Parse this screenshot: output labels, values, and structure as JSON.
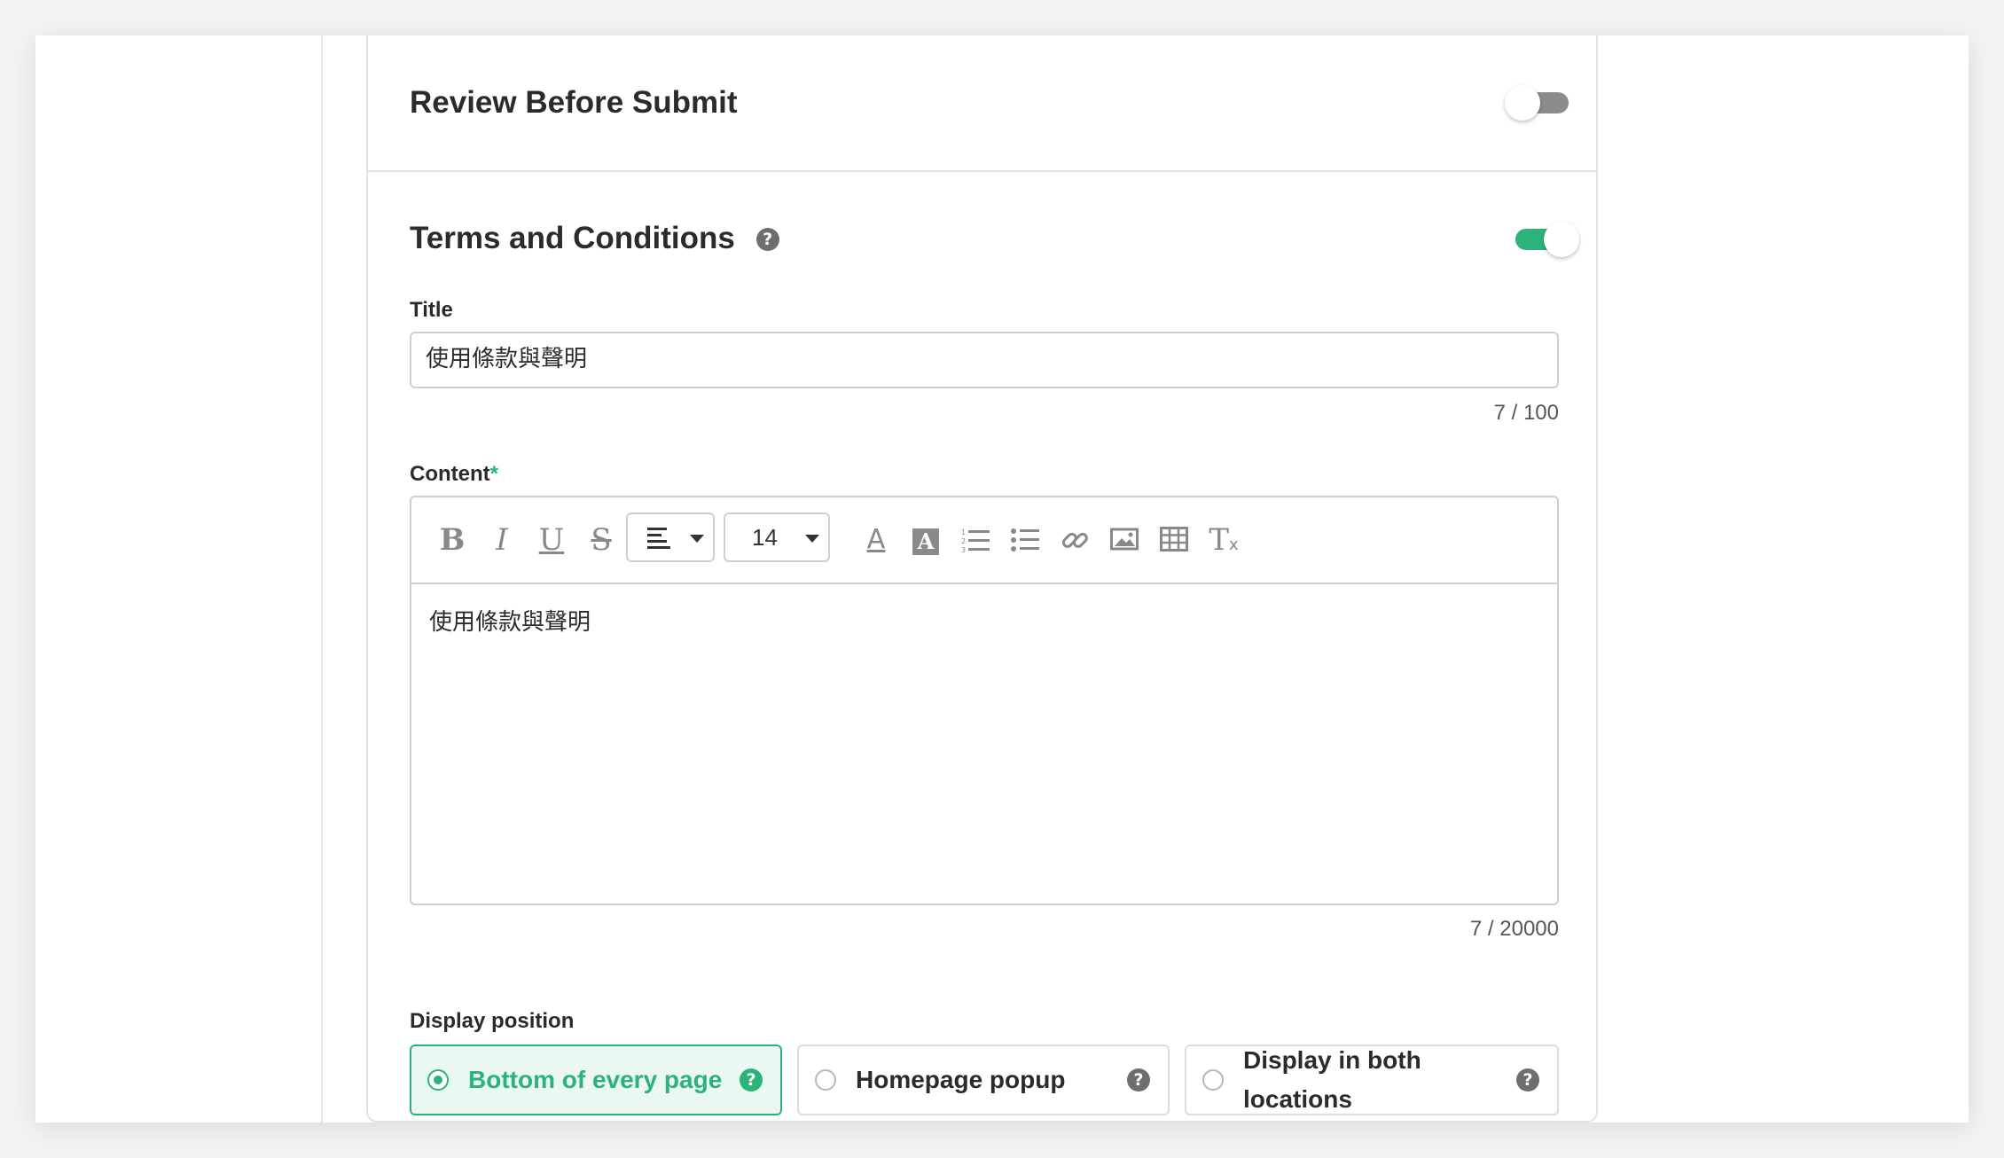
{
  "review": {
    "title": "Review Before Submit",
    "enabled": false
  },
  "terms": {
    "title": "Terms and Conditions",
    "help_icon": "question-circle-icon",
    "enabled": true,
    "title_field": {
      "label": "Title",
      "value": "使用條款與聲明",
      "counter": "7 / 100"
    },
    "content_field": {
      "label": "Content",
      "required_mark": "*",
      "toolbar": {
        "bold": "B",
        "italic": "I",
        "underline": "U",
        "strike": "S",
        "align_icon": "align-left-icon",
        "font_size": "14",
        "font_color": "A",
        "bg_color": "A",
        "clear_format": "T"
      },
      "text": "使用條款與聲明",
      "counter": "7 / 20000"
    },
    "display_position": {
      "label": "Display position",
      "options": [
        {
          "label": "Bottom of every page",
          "selected": true
        },
        {
          "label": "Homepage popup",
          "selected": false
        },
        {
          "label": "Display in both locations",
          "selected": false
        }
      ],
      "help_glyph": "?"
    }
  },
  "colors": {
    "accent": "#2bb37a",
    "border": "#cfcfcf",
    "toggle_off": "#8c8c8c"
  }
}
